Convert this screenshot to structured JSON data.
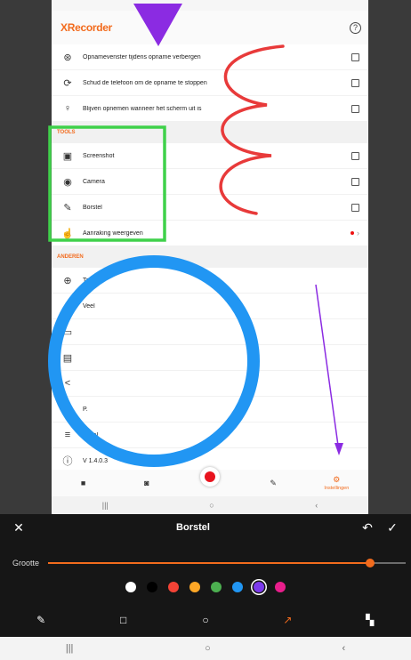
{
  "app": {
    "logo": "XRecorder",
    "help_icon": "help-circle-icon"
  },
  "settings_rows": [
    {
      "icon": "eye-off-icon",
      "label": "Opnamevenster tijdens opname verbergen",
      "control": "checkbox",
      "checked": false
    },
    {
      "icon": "shake-phone-icon",
      "label": "Schud de telefoon om de opname te stoppen",
      "control": "checkbox",
      "checked": false
    },
    {
      "icon": "bulb-icon",
      "label": "Blijven opnemen wanneer het scherm uit is",
      "control": "checkbox",
      "checked": false
    }
  ],
  "tools_section": {
    "header": "TOOLS",
    "rows": [
      {
        "icon": "camera-screenshot-icon",
        "label": "Screenshot",
        "control": "checkbox"
      },
      {
        "icon": "webcam-icon",
        "label": "Camera",
        "control": "checkbox"
      },
      {
        "icon": "brush-icon",
        "label": "Borstel",
        "control": "checkbox"
      },
      {
        "icon": "touch-icon",
        "label": "Aanraking weergeven",
        "control": "arrow"
      }
    ]
  },
  "others_section": {
    "header": "ANDEREN",
    "rows": [
      {
        "icon": "globe-icon",
        "label": "Taal"
      },
      {
        "icon": "",
        "label": "Veel"
      },
      {
        "icon": "chat-icon",
        "label": ""
      },
      {
        "icon": "document-icon",
        "label": ""
      },
      {
        "icon": "share-icon",
        "label": ""
      },
      {
        "icon": "visibility-icon",
        "label": "P."
      },
      {
        "icon": "legal-icon",
        "label": "Legal"
      },
      {
        "icon": "info-icon",
        "label": "V 1.4.0.3"
      }
    ]
  },
  "bottom_nav": {
    "items": [
      {
        "icon": "video-icon",
        "label": ""
      },
      {
        "icon": "camera-icon",
        "label": ""
      },
      {
        "icon": "record-icon",
        "label": ""
      },
      {
        "icon": "pencil-icon",
        "label": ""
      },
      {
        "icon": "gear-icon",
        "label": "Instellingen"
      }
    ]
  },
  "brush_toolbar": {
    "title": "Borstel",
    "close_icon": "close-icon",
    "undo_icon": "undo-icon",
    "confirm_icon": "check-icon",
    "size_label": "Grootte",
    "size_value": 0.9,
    "colors": [
      "#ffffff",
      "#000000",
      "#f44336",
      "#ffa726",
      "#4caf50",
      "#2196f3",
      "#7c3aed",
      "#e91e8c"
    ],
    "selected_color_index": 6,
    "tools": [
      "brush-icon",
      "square-icon",
      "circle-icon",
      "arrow-icon",
      "mosaic-icon"
    ],
    "active_tool_index": 3
  },
  "system_nav": {
    "recents": "|||",
    "home": "○",
    "back": "‹"
  }
}
